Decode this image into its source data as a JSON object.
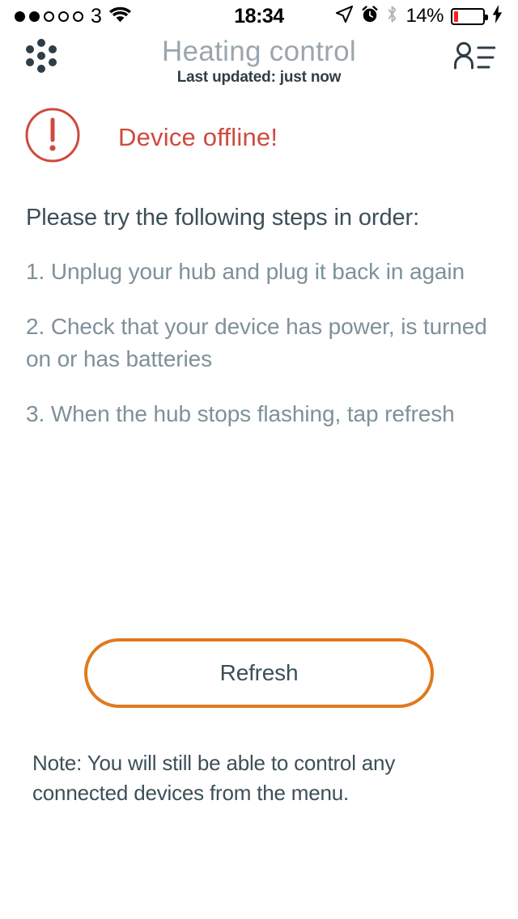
{
  "status_bar": {
    "signal_dots_total": 5,
    "signal_dots_filled": 2,
    "carrier": "3",
    "wifi_icon": "wifi-icon",
    "time": "18:34",
    "location_icon": "location-arrow-icon",
    "alarm_icon": "alarm-clock-icon",
    "bluetooth_icon": "bluetooth-icon",
    "battery_percent": "14%",
    "battery_level": 14,
    "battery_color": "#ff1f1f",
    "charging_icon": "lightning-bolt-icon"
  },
  "header": {
    "menu_icon": "dots-grid-icon",
    "title": "Heating control",
    "subtitle": "Last updated: just now",
    "account_icon": "contact-list-icon"
  },
  "alert": {
    "icon": "exclamation-circle-icon",
    "message": "Device offline!",
    "color": "#cf4a3e"
  },
  "main": {
    "intro": "Please try the following steps in order:",
    "steps": [
      "1. Unplug your hub and plug it back in again",
      "2. Check that your device has power, is turned on or has batteries",
      "3. When the hub stops flashing, tap refresh"
    ],
    "refresh_label": "Refresh",
    "refresh_border_color": "#e0791f",
    "note": "Note: You will still be able to control any connected devices from the menu."
  },
  "colors": {
    "dark_slate": "#2f3e46",
    "body_text": "#3c4f58",
    "muted_step": "#7e9199",
    "title_grey": "#9aa6ad",
    "accent_orange": "#e0791f",
    "error_red": "#cf4a3e"
  }
}
